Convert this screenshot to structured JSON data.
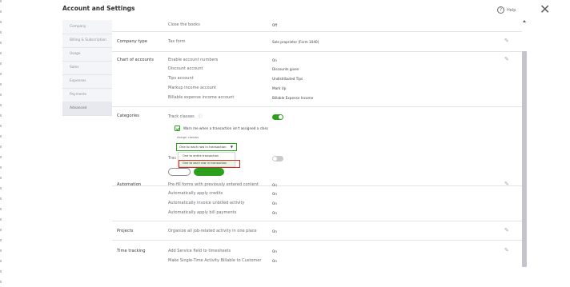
{
  "header": {
    "title": "Account and Settings",
    "help_label": "Help"
  },
  "sidebar": {
    "items": [
      {
        "label": "Company"
      },
      {
        "label": "Billing & Subscription"
      },
      {
        "label": "Usage"
      },
      {
        "label": "Sales"
      },
      {
        "label": "Expenses"
      },
      {
        "label": "Payments"
      },
      {
        "label": "Advanced"
      }
    ]
  },
  "sections": {
    "close_books": {
      "label": "Close the books",
      "value": "Off"
    },
    "company_type": {
      "title": "Company type",
      "rows": [
        {
          "label": "Tax form",
          "value": "Sole proprietor (Form 1040)"
        }
      ]
    },
    "chart_of_accounts": {
      "title": "Chart of accounts",
      "rows": [
        {
          "label": "Enable account numbers",
          "value": "On"
        },
        {
          "label": "Discount account",
          "value": "Discounts given"
        },
        {
          "label": "Tips account",
          "value": "Undistributed Tips"
        },
        {
          "label": "Markup income account",
          "value": "Mark Up"
        },
        {
          "label": "Billable expense income account",
          "value": "Billable Expense Income"
        }
      ]
    },
    "categories": {
      "title": "Categories",
      "track_classes_label": "Track classes",
      "track_classes_enabled": true,
      "warn_label": "Warn me when a transaction isn't assigned a class",
      "warn_checked": true,
      "assign_classes_label": "Assign classes",
      "select_value": "One to each row in transaction",
      "dropdown_options": [
        {
          "label": "One to entire transaction"
        },
        {
          "label": "One to each row in transaction"
        }
      ],
      "track_locations_label_partial": "Trac",
      "track_locations_enabled": false,
      "cancel_label": "",
      "save_label": ""
    },
    "automation": {
      "title": "Automation",
      "rows": [
        {
          "label": "Pre-fill forms with previously entered content",
          "value": "On"
        },
        {
          "label": "Automatically apply credits",
          "value": "On"
        },
        {
          "label": "Automatically invoice unbilled activity",
          "value": "On"
        },
        {
          "label": "Automatically apply bill payments",
          "value": "On"
        }
      ]
    },
    "projects": {
      "title": "Projects",
      "rows": [
        {
          "label": "Organize all job-related activity in one place",
          "value": "On"
        }
      ]
    },
    "time_tracking": {
      "title": "Time tracking",
      "rows": [
        {
          "label": "Add Service field to timesheets",
          "value": "On"
        },
        {
          "label": "Make Single-Time Activity Billable to Customer",
          "value": "On"
        }
      ]
    }
  },
  "icons": {
    "edit": "pencil-icon",
    "help": "question-circle-icon",
    "close": "close-icon",
    "info": "info-icon"
  },
  "colors": {
    "accent_green": "#2ca01c",
    "highlight_red": "#d52b1e"
  }
}
